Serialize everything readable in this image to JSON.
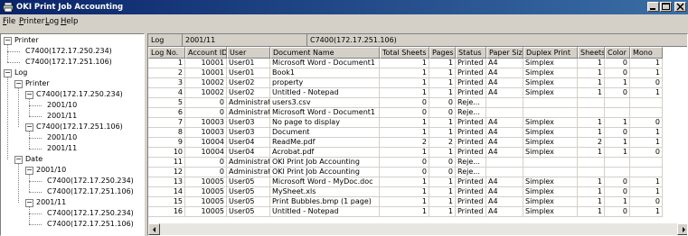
{
  "window": {
    "title": "OKI Print Job Accounting"
  },
  "menu": [
    {
      "label": "File",
      "key": "F",
      "rest": "ile"
    },
    {
      "label": "Printer",
      "key": "P",
      "rest": "rinter"
    },
    {
      "label": "Log",
      "key": "L",
      "rest": "og"
    },
    {
      "label": "Help",
      "key": "H",
      "rest": "elp"
    }
  ],
  "tree": [
    {
      "label": "Printer",
      "level": 0,
      "box": "minus"
    },
    {
      "label": "C7400(172.17.250.234)",
      "level": 1,
      "box": ""
    },
    {
      "label": "C7400(172.17.251.106)",
      "level": 1,
      "box": ""
    },
    {
      "label": "Log",
      "level": 0,
      "box": "minus"
    },
    {
      "label": "Printer",
      "level": 1,
      "box": "minus"
    },
    {
      "label": "C7400(172.17.250.234)",
      "level": 2,
      "box": "minus"
    },
    {
      "label": "2001/10",
      "level": 3,
      "box": ""
    },
    {
      "label": "2001/11",
      "level": 3,
      "box": ""
    },
    {
      "label": "C7400(172.17.251.106)",
      "level": 2,
      "box": "minus"
    },
    {
      "label": "2001/10",
      "level": 3,
      "box": ""
    },
    {
      "label": "2001/11",
      "level": 3,
      "box": ""
    },
    {
      "label": "Date",
      "level": 1,
      "box": "minus"
    },
    {
      "label": "2001/10",
      "level": 2,
      "box": "minus"
    },
    {
      "label": "C7400(172.17.250.234)",
      "level": 3,
      "box": ""
    },
    {
      "label": "C7400(172.17.251.106)",
      "level": 3,
      "box": ""
    },
    {
      "label": "2001/11",
      "level": 2,
      "box": "minus"
    },
    {
      "label": "C7400(172.17.250.234)",
      "level": 3,
      "box": ""
    },
    {
      "label": "C7400(172.17.251.106)",
      "level": 3,
      "box": ""
    }
  ],
  "info": {
    "type": "Log",
    "period": "2001/11",
    "printer": "C7400(172.17.251.106)"
  },
  "columns": [
    "Log No.",
    "Account ID",
    "User",
    "Document Name",
    "Total Sheets",
    "Pages",
    "Status",
    "Paper Size",
    "Duplex Print",
    "Sheets",
    "Color",
    "Mono"
  ],
  "rows": [
    [
      "1",
      "10001",
      "User01",
      "Microsoft Word - Document1",
      "1",
      "1",
      "Printed",
      "A4",
      "Simplex",
      "1",
      "0",
      "1"
    ],
    [
      "2",
      "10001",
      "User01",
      "Book1",
      "1",
      "1",
      "Printed",
      "A4",
      "Simplex",
      "1",
      "0",
      "1"
    ],
    [
      "3",
      "10002",
      "User02",
      "property",
      "1",
      "1",
      "Printed",
      "A4",
      "Simplex",
      "1",
      "1",
      "0"
    ],
    [
      "4",
      "10002",
      "User02",
      "Untitled - Notepad",
      "1",
      "1",
      "Printed",
      "A4",
      "Simplex",
      "1",
      "0",
      "1"
    ],
    [
      "5",
      "0",
      "Administrator",
      "users3.csv",
      "0",
      "0",
      "Reje...",
      "",
      "",
      "",
      "",
      ""
    ],
    [
      "6",
      "0",
      "Administrator",
      "Microsoft Word - Document1",
      "0",
      "0",
      "Reje...",
      "",
      "",
      "",
      "",
      ""
    ],
    [
      "7",
      "10003",
      "User03",
      "No page to display",
      "1",
      "1",
      "Printed",
      "A4",
      "Simplex",
      "1",
      "1",
      "0"
    ],
    [
      "8",
      "10003",
      "User03",
      "Document",
      "1",
      "1",
      "Printed",
      "A4",
      "Simplex",
      "1",
      "0",
      "1"
    ],
    [
      "9",
      "10004",
      "User04",
      "ReadMe.pdf",
      "2",
      "2",
      "Printed",
      "A4",
      "Simplex",
      "2",
      "1",
      "1"
    ],
    [
      "10",
      "10004",
      "User04",
      "Acrobat.pdf",
      "1",
      "1",
      "Printed",
      "A4",
      "Simplex",
      "1",
      "1",
      "0"
    ],
    [
      "11",
      "0",
      "Administrator",
      "OKI Print Job Accounting",
      "0",
      "0",
      "Reje...",
      "",
      "",
      "",
      "",
      ""
    ],
    [
      "12",
      "0",
      "Administrator",
      "OKI Print Job Accounting",
      "0",
      "0",
      "Reje...",
      "",
      "",
      "",
      "",
      ""
    ],
    [
      "13",
      "10005",
      "User05",
      "Microsoft Word - MyDoc.doc",
      "1",
      "1",
      "Printed",
      "A4",
      "Simplex",
      "1",
      "0",
      "1"
    ],
    [
      "14",
      "10005",
      "User05",
      "MySheet.xls",
      "1",
      "1",
      "Printed",
      "A4",
      "Simplex",
      "1",
      "0",
      "1"
    ],
    [
      "15",
      "10005",
      "User05",
      "Print Bubbles.bmp (1 page)",
      "1",
      "1",
      "Printed",
      "A4",
      "Simplex",
      "1",
      "1",
      "0"
    ],
    [
      "16",
      "10005",
      "User05",
      "Untitled - Notepad",
      "1",
      "1",
      "Printed",
      "A4",
      "Simplex",
      "1",
      "0",
      "1"
    ]
  ],
  "icons": {
    "app": "printer-icon",
    "minimize": "minimize-icon",
    "maximize": "maximize-icon",
    "close": "close-icon",
    "scroll_left": "arrow-left-icon",
    "scroll_right": "arrow-right-icon"
  },
  "colors": {
    "titlebar_start": "#0a246a",
    "titlebar_end": "#3a6ea5",
    "face": "#d4d0c8"
  }
}
